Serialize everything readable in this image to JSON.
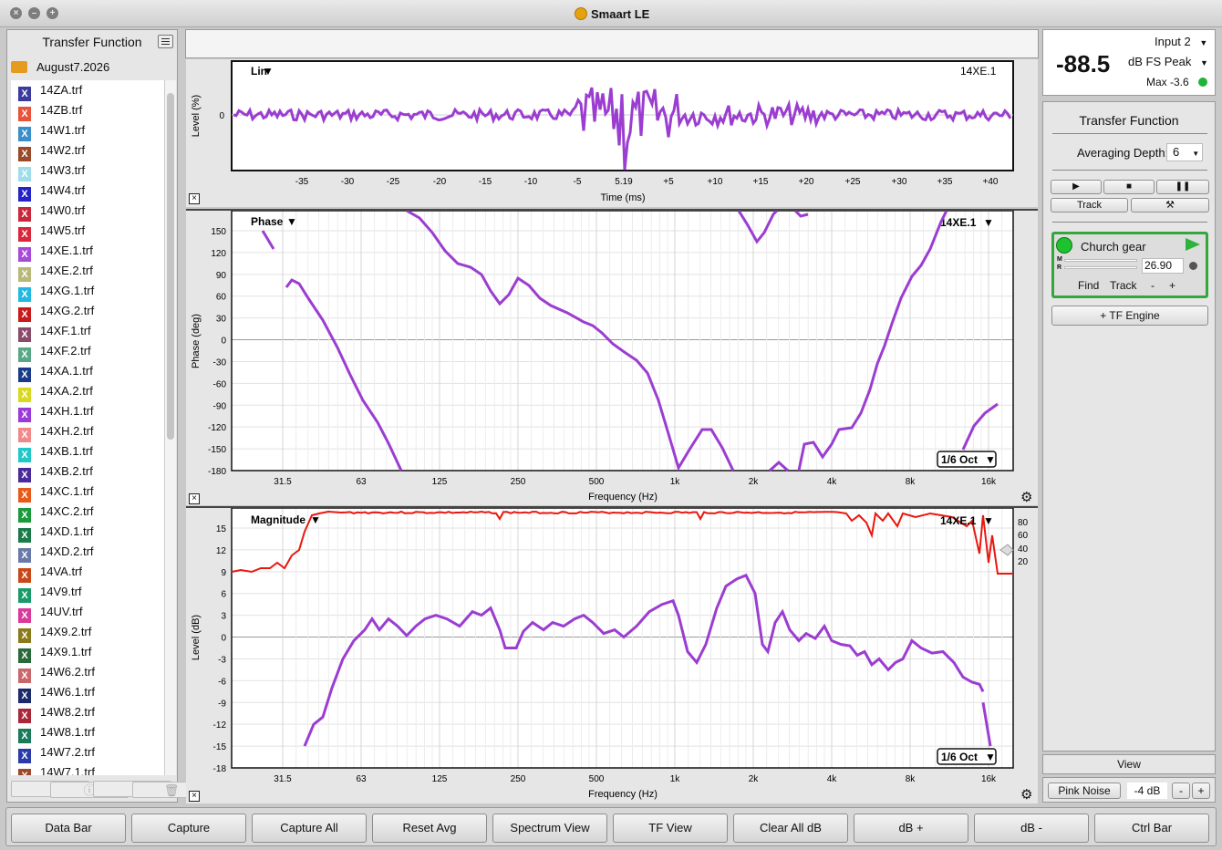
{
  "window": {
    "title": "Smaart LE"
  },
  "sidebar": {
    "header": "Transfer Function",
    "folder": "August7.2026",
    "files": [
      {
        "name": "14ZA.trf",
        "color": "#3b3b9e"
      },
      {
        "name": "14ZB.trf",
        "color": "#e8533a"
      },
      {
        "name": "14W1.trf",
        "color": "#3a8fc9"
      },
      {
        "name": "14W2.trf",
        "color": "#9a4a2a"
      },
      {
        "name": "14W3.trf",
        "color": "#9fdde8"
      },
      {
        "name": "14W4.trf",
        "color": "#2323c8"
      },
      {
        "name": "14W0.trf",
        "color": "#c8283a"
      },
      {
        "name": "14W5.trf",
        "color": "#d8283a"
      },
      {
        "name": "14XE.1.trf",
        "color": "#a84ad8"
      },
      {
        "name": "14XE.2.trf",
        "color": "#b8b878"
      },
      {
        "name": "14XG.1.trf",
        "color": "#22b8e0"
      },
      {
        "name": "14XG.2.trf",
        "color": "#c81a1a"
      },
      {
        "name": "14XF.1.trf",
        "color": "#8a4a6a"
      },
      {
        "name": "14XF.2.trf",
        "color": "#58a888"
      },
      {
        "name": "14XA.1.trf",
        "color": "#1a3a8a"
      },
      {
        "name": "14XA.2.trf",
        "color": "#d8d822"
      },
      {
        "name": "14XH.1.trf",
        "color": "#9a3ad8"
      },
      {
        "name": "14XH.2.trf",
        "color": "#f08a8a"
      },
      {
        "name": "14XB.1.trf",
        "color": "#22c8c8"
      },
      {
        "name": "14XB.2.trf",
        "color": "#4a2a9a"
      },
      {
        "name": "14XC.1.trf",
        "color": "#e85a1a"
      },
      {
        "name": "14XC.2.trf",
        "color": "#1a9a3a"
      },
      {
        "name": "14XD.1.trf",
        "color": "#1a7a4a"
      },
      {
        "name": "14XD.2.trf",
        "color": "#6a7aa8"
      },
      {
        "name": "14VA.trf",
        "color": "#c8481a"
      },
      {
        "name": "14V9.trf",
        "color": "#1a9a6a"
      },
      {
        "name": "14UV.trf",
        "color": "#d83a9a"
      },
      {
        "name": "14X9.2.trf",
        "color": "#8a7a1a"
      },
      {
        "name": "14X9.1.trf",
        "color": "#2a6a3a"
      },
      {
        "name": "14W6.2.trf",
        "color": "#c8686a"
      },
      {
        "name": "14W6.1.trf",
        "color": "#1a2a6a"
      },
      {
        "name": "14W8.2.trf",
        "color": "#a8283a"
      },
      {
        "name": "14W8.1.trf",
        "color": "#1a7a5a"
      },
      {
        "name": "14W7.2.trf",
        "color": "#2a3aa8"
      },
      {
        "name": "14W7.1.trf",
        "color": "#9a4a2a"
      }
    ]
  },
  "impulse": {
    "mode": "Lin",
    "trace": "14XE.1",
    "ylabel": "Level (%)",
    "xlabel": "Time (ms)",
    "yticks": [
      "0"
    ],
    "xticks": [
      "-35",
      "-30",
      "-25",
      "-20",
      "-15",
      "-10",
      "-5",
      "5.19",
      "+5",
      "+10",
      "+15",
      "+20",
      "+25",
      "+30",
      "+35",
      "+40"
    ]
  },
  "phase": {
    "title": "Phase",
    "trace": "14XE.1",
    "ylabel": "Phase (deg)",
    "xlabel": "Frequency (Hz)",
    "smoothing": "1/6 Oct",
    "yticks": [
      "150",
      "120",
      "90",
      "60",
      "30",
      "0",
      "-30",
      "-60",
      "-90",
      "-120",
      "-150",
      "-180"
    ],
    "xticks": [
      "31.5",
      "63",
      "125",
      "250",
      "500",
      "1k",
      "2k",
      "4k",
      "8k",
      "16k"
    ]
  },
  "magnitude": {
    "title": "Magnitude",
    "trace": "14XE.1",
    "ylabel": "Level (dB)",
    "xlabel": "Frequency (Hz)",
    "smoothing": "1/6 Oct",
    "yticks": [
      "15",
      "12",
      "9",
      "6",
      "3",
      "0",
      "-3",
      "-6",
      "-9",
      "-12",
      "-15",
      "-18"
    ],
    "xticks": [
      "31.5",
      "63",
      "125",
      "250",
      "500",
      "1k",
      "2k",
      "4k",
      "8k",
      "16k"
    ],
    "coherence_ticks": [
      "80",
      "60",
      "40",
      "20"
    ]
  },
  "chart_data": [
    {
      "type": "line",
      "name": "phase",
      "series": [
        {
          "name": "14XE.1",
          "color": "#9b3dd1"
        }
      ],
      "x_scale": "log",
      "xlim": [
        20,
        20000
      ],
      "ylim": [
        -180,
        180
      ]
    },
    {
      "type": "line",
      "name": "magnitude",
      "series": [
        {
          "name": "14XE.1",
          "color": "#9b3dd1"
        }
      ],
      "x_scale": "log",
      "xlim": [
        20,
        20000
      ],
      "ylim": [
        -18,
        18
      ]
    }
  ],
  "meter": {
    "value": "-88.5",
    "input": "Input 2",
    "units": "dB FS Peak",
    "max": "Max -3.6"
  },
  "control": {
    "title": "Transfer Function",
    "averaging_label": "Averaging Depth:",
    "averaging_value": "6",
    "track_label": "Track",
    "tf_engine": "+ TF Engine",
    "view_label": "View",
    "pink_noise": "Pink Noise",
    "pink_level": "-4 dB",
    "engine": {
      "name": "Church gear",
      "delay": "26.90",
      "find": "Find",
      "track": "Track",
      "minus": "-",
      "plus": "+"
    }
  },
  "bottom": {
    "buttons": [
      "Data Bar",
      "Capture",
      "Capture All",
      "Reset Avg",
      "Spectrum View",
      "TF View",
      "Clear All dB",
      "dB +",
      "dB -",
      "Ctrl Bar"
    ]
  }
}
